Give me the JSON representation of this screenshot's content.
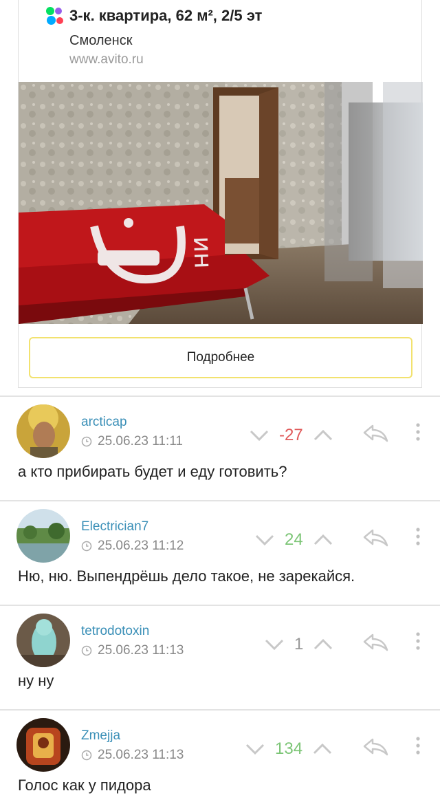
{
  "preview": {
    "title": "3-к. квартира, 62 м², 2/5 эт",
    "city": "Смоленск",
    "url": "www.avito.ru",
    "more_label": "Подробнее",
    "logo_icon": "avito-logo-icon",
    "logo_colors": [
      "#965eeb",
      "#ff4053",
      "#04e061",
      "#0af"
    ]
  },
  "comments": [
    {
      "author": "arcticap",
      "timestamp": "25.06.23 11:11",
      "rating": "-27",
      "rating_color": "#e05a5a",
      "text": "а кто прибирать будет и еду готовить?"
    },
    {
      "author": "Electrician7",
      "timestamp": "25.06.23 11:12",
      "rating": "24",
      "rating_color": "#7cc576",
      "text": "Ню, ню. Выпендрёшь дело такое, не зарекайся."
    },
    {
      "author": "tetrodotoxin",
      "timestamp": "25.06.23 11:13",
      "rating": "1",
      "rating_color": "#999999",
      "text": "ну ну"
    },
    {
      "author": "Zmejja",
      "timestamp": "25.06.23 11:13",
      "rating": "134",
      "rating_color": "#7cc576",
      "text": "Голос как у пидора"
    }
  ],
  "icons": {
    "vote_down": "chevron-down-icon",
    "vote_up": "chevron-up-icon",
    "reply": "reply-arrow-icon",
    "menu": "vertical-dots-icon",
    "time": "clock-icon"
  }
}
